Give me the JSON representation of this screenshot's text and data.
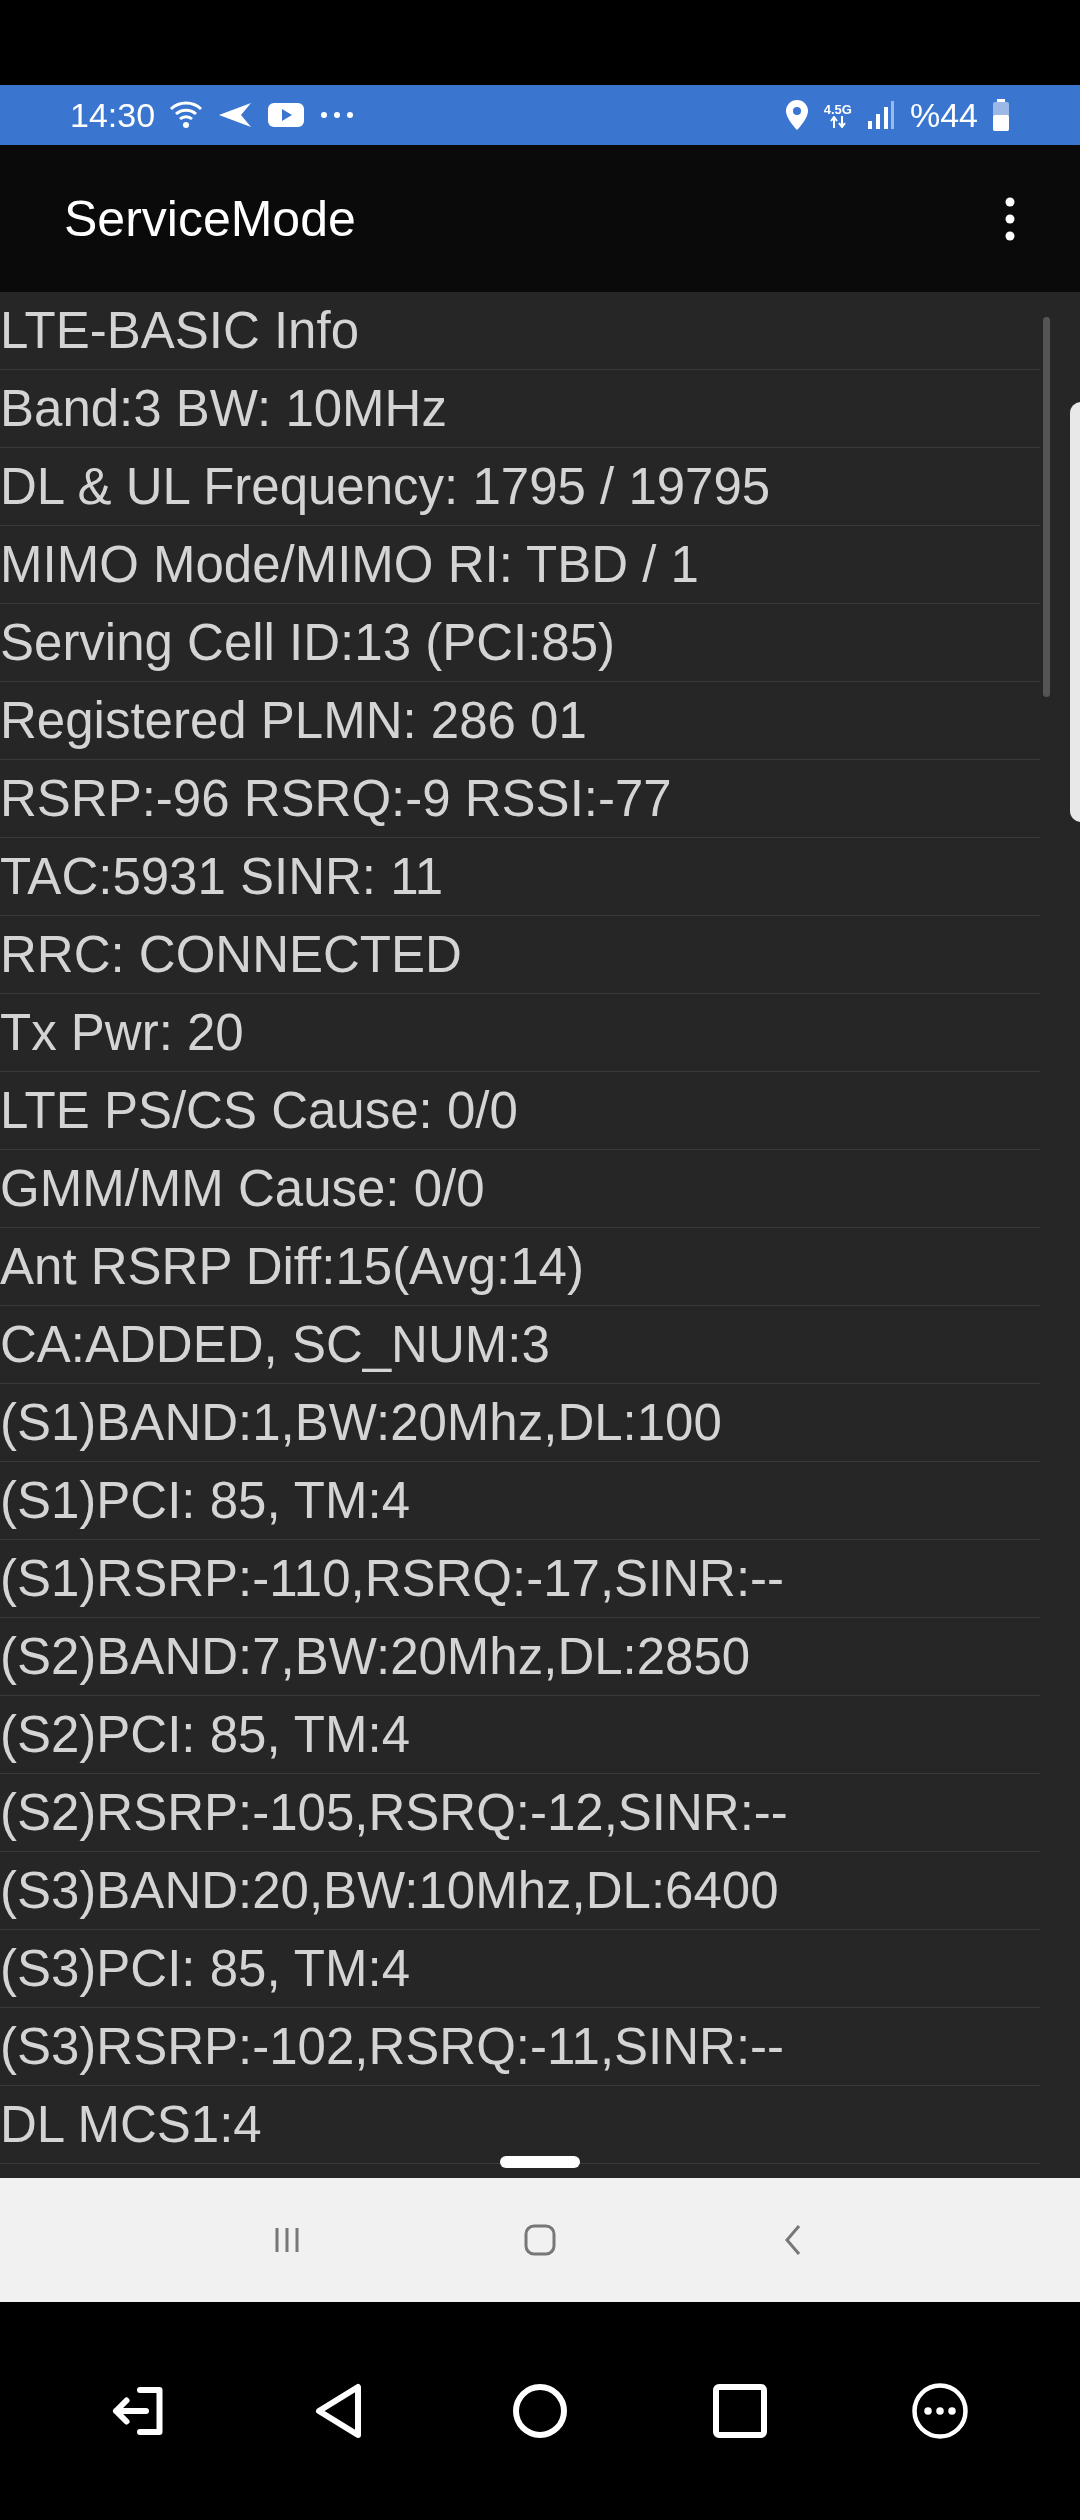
{
  "status_bar": {
    "time": "14:30",
    "network_type": "4.5G",
    "battery": "%44"
  },
  "app_bar": {
    "title": "ServiceMode"
  },
  "rows": [
    "LTE-BASIC Info",
    "Band:3 BW: 10MHz",
    "DL & UL Frequency: 1795 / 19795",
    "MIMO Mode/MIMO RI: TBD / 1",
    "Serving Cell ID:13 (PCI:85)",
    "Registered PLMN: 286 01",
    "RSRP:-96 RSRQ:-9 RSSI:-77",
    "TAC:5931 SINR: 11",
    "RRC: CONNECTED",
    "Tx Pwr: 20",
    "LTE PS/CS Cause: 0/0",
    "GMM/MM Cause: 0/0",
    "Ant RSRP Diff:15(Avg:14)",
    "CA:ADDED, SC_NUM:3",
    "(S1)BAND:1,BW:20Mhz,DL:100",
    "(S1)PCI: 85, TM:4",
    "(S1)RSRP:-110,RSRQ:-17,SINR:--",
    "(S2)BAND:7,BW:20Mhz,DL:2850",
    "(S2)PCI: 85, TM:4",
    "(S2)RSRP:-105,RSRQ:-12,SINR:--",
    "(S3)BAND:20,BW:10Mhz,DL:6400",
    "(S3)PCI: 85, TM:4",
    "(S3)RSRP:-102,RSRQ:-11,SINR:--",
    "DL MCS1:4"
  ]
}
